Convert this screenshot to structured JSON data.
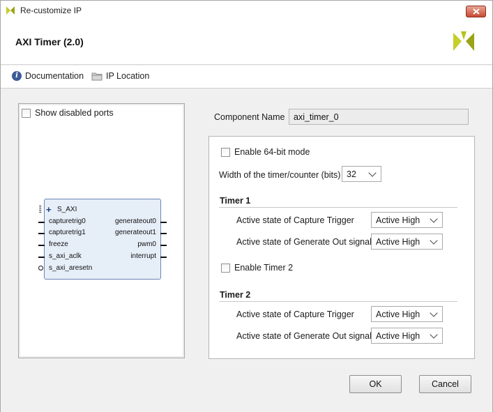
{
  "window": {
    "title": "Re-customize IP"
  },
  "header": {
    "ip_title": "AXI Timer (2.0)"
  },
  "toolbar": {
    "documentation": "Documentation",
    "ip_location": "IP Location"
  },
  "left_panel": {
    "show_disabled_ports": "Show disabled ports",
    "block": {
      "interface": "S_AXI",
      "left_ports": [
        "capturetrig0",
        "capturetrig1",
        "freeze",
        "s_axi_aclk",
        "s_axi_aresetn"
      ],
      "right_ports": [
        "generateout0",
        "generateout1",
        "pwm0",
        "interrupt"
      ]
    }
  },
  "component": {
    "label": "Component Name",
    "value": "axi_timer_0"
  },
  "config": {
    "enable_64bit": "Enable 64-bit mode",
    "width_label": "Width of the timer/counter (bits)",
    "width_value": "32",
    "timer1": {
      "title": "Timer 1",
      "capture_label": "Active state of Capture Trigger",
      "capture_value": "Active High",
      "generate_label": "Active state of Generate Out signal",
      "generate_value": "Active High"
    },
    "enable_timer2": "Enable Timer 2",
    "timer2": {
      "title": "Timer 2",
      "capture_label": "Active state of Capture Trigger",
      "capture_value": "Active High",
      "generate_label": "Active state of Generate Out signal",
      "generate_value": "Active High"
    }
  },
  "buttons": {
    "ok": "OK",
    "cancel": "Cancel"
  },
  "colors": {
    "xilinx_logo": "#b5c21a",
    "close_button": "#c74a33",
    "info_icon": "#3d5a97",
    "block_fill": "#e6eef8",
    "block_border": "#6b86b3"
  }
}
